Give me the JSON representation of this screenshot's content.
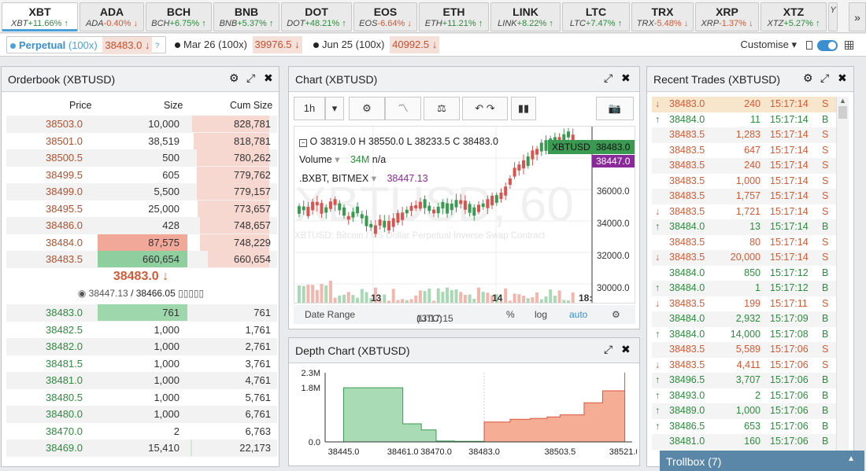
{
  "tickers": [
    {
      "sym": "XBT",
      "code": "XBT",
      "chg": "+11.66%",
      "dir": "up",
      "active": true
    },
    {
      "sym": "ADA",
      "code": "ADA",
      "chg": "-0.40%",
      "dir": "dn"
    },
    {
      "sym": "BCH",
      "code": "BCH",
      "chg": "+6.75%",
      "dir": "up"
    },
    {
      "sym": "BNB",
      "code": "BNB",
      "chg": "+5.37%",
      "dir": "up"
    },
    {
      "sym": "DOT",
      "code": "DOT",
      "chg": "+48.21%",
      "dir": "up"
    },
    {
      "sym": "EOS",
      "code": "EOS",
      "chg": "-6.64%",
      "dir": "dn"
    },
    {
      "sym": "ETH",
      "code": "ETH",
      "chg": "+11.21%",
      "dir": "up"
    },
    {
      "sym": "LINK",
      "code": "LINK",
      "chg": "+8.22%",
      "dir": "up"
    },
    {
      "sym": "LTC",
      "code": "LTC",
      "chg": "+7.47%",
      "dir": "up"
    },
    {
      "sym": "TRX",
      "code": "TRX",
      "chg": "-5.48%",
      "dir": "dn"
    },
    {
      "sym": "XRP",
      "code": "XRP",
      "chg": "-1.37%",
      "dir": "dn"
    },
    {
      "sym": "XTZ",
      "code": "XTZ",
      "chg": "+5.27%",
      "dir": "up"
    },
    {
      "sym": "",
      "code": "Y",
      "chg": "",
      "dir": "up"
    }
  ],
  "more_label": "»",
  "contracts": {
    "perp": {
      "name": "Perpetual",
      "lev": "(100x)",
      "price": "38483.0",
      "arrow": "↓",
      "help": "?"
    },
    "mar": {
      "name": "Mar 26 (100x)",
      "price": "39976.5",
      "arrow": "↓"
    },
    "jun": {
      "name": "Jun 25 (100x)",
      "price": "40992.5",
      "arrow": "↓"
    },
    "customise": "Customise ▾"
  },
  "orderbook": {
    "title": "Orderbook (XBTUSD)",
    "headers": {
      "price": "Price",
      "size": "Size",
      "cum": "Cum Size"
    },
    "asks": [
      {
        "price": "38503.0",
        "size": "10,000",
        "cum": "828,781",
        "cum_frac": 0.98
      },
      {
        "price": "38501.0",
        "size": "38,519",
        "cum": "818,781",
        "cum_frac": 0.96
      },
      {
        "price": "38500.5",
        "size": "500",
        "cum": "780,262",
        "cum_frac": 0.92
      },
      {
        "price": "38499.5",
        "size": "605",
        "cum": "779,762",
        "cum_frac": 0.92
      },
      {
        "price": "38499.0",
        "size": "5,500",
        "cum": "779,157",
        "cum_frac": 0.92
      },
      {
        "price": "38495.5",
        "size": "25,000",
        "cum": "773,657",
        "cum_frac": 0.91
      },
      {
        "price": "38486.0",
        "size": "428",
        "cum": "748,657",
        "cum_frac": 0.88
      },
      {
        "price": "38484.0",
        "size": "87,575",
        "cum": "748,229",
        "cum_frac": 0.88,
        "size_frac": 1.0
      },
      {
        "price": "38483.5",
        "size": "660,654",
        "cum": "660,654",
        "cum_frac": 0.78,
        "size_frac": 1.0
      }
    ],
    "last_price": "38483.0 ↓",
    "index_icon": "◉",
    "index": "38447.13",
    "fair": "/ 38466.05",
    "boxes": "▯▯▯▯▯",
    "bids": [
      {
        "price": "38483.0",
        "size": "761",
        "cum": "761",
        "cum_frac": 0.0,
        "size_frac": 1.0
      },
      {
        "price": "38482.5",
        "size": "1,000",
        "cum": "1,761",
        "cum_frac": 0.0
      },
      {
        "price": "38482.0",
        "size": "1,000",
        "cum": "2,761",
        "cum_frac": 0.0
      },
      {
        "price": "38481.5",
        "size": "1,000",
        "cum": "3,761",
        "cum_frac": 0.0
      },
      {
        "price": "38481.0",
        "size": "1,000",
        "cum": "4,761",
        "cum_frac": 0.0
      },
      {
        "price": "38480.5",
        "size": "1,000",
        "cum": "5,761",
        "cum_frac": 0.0
      },
      {
        "price": "38480.0",
        "size": "1,000",
        "cum": "6,761",
        "cum_frac": 0.0
      },
      {
        "price": "38470.0",
        "size": "2",
        "cum": "6,763",
        "cum_frac": 0.0
      },
      {
        "price": "38469.0",
        "size": "15,410",
        "cum": "22,173",
        "cum_frac": 0.02
      }
    ]
  },
  "chart": {
    "title": "Chart (XBTUSD)",
    "interval": "1h",
    "ohlc": {
      "o_label": "O",
      "o": "38319.0",
      "h_label": "H",
      "h": "38550.0",
      "l_label": "L",
      "l": "38233.5",
      "c_label": "C",
      "c": "38483.0"
    },
    "volume_label": "Volume",
    "volume_value": "34M",
    "volume_na": "n/a",
    "index_label": ".BXBT, BITMEX",
    "index_value": "38447.13",
    "watermark": "XBTUSD, 60",
    "watermark_sub": "XBTUSD: Bitcoin / US Dollar Perpetual Inverse Swap Contract",
    "symbol_tag": "XBTUSD",
    "price_tag": "38483.0",
    "index_tag": "38447.0",
    "y_ticks": [
      "36000.0",
      "34000.0",
      "32000.0",
      "30000.0"
    ],
    "x_ticks": [
      "13",
      "14",
      "18:"
    ],
    "footer": {
      "range": "Date Range",
      "time": "13:17:15",
      "tz": "(UTC)",
      "pct": "%",
      "log": "log",
      "auto": "auto"
    }
  },
  "depth": {
    "title": "Depth Chart (XBTUSD)",
    "y_ticks": [
      "2.3M",
      "1.8M",
      "0.0"
    ],
    "x_ticks": [
      "38445.0",
      "38461.0",
      "38470.0",
      "38483.0",
      "38503.5",
      "38521.0"
    ]
  },
  "chart_data": {
    "type": "area",
    "title": "Depth Chart (XBTUSD)",
    "xlabel": "",
    "ylabel": "",
    "ylim": [
      0,
      2300000
    ],
    "series": [
      {
        "name": "bids",
        "x": [
          38445.0,
          38450.0,
          38461.0,
          38466.0,
          38470.0,
          38475.0,
          38483.0
        ],
        "values": [
          1800000,
          1800000,
          600000,
          400000,
          30000,
          20000,
          0
        ]
      },
      {
        "name": "asks",
        "x": [
          38483.0,
          38490.0,
          38495.5,
          38500.0,
          38503.5,
          38510.0,
          38515.0,
          38521.0
        ],
        "values": [
          660000,
          750000,
          780000,
          830000,
          900000,
          1300000,
          1700000,
          2300000
        ]
      }
    ]
  },
  "trades": {
    "title": "Recent Trades (XBTUSD)",
    "rows": [
      {
        "price": "38483.0",
        "size": "240",
        "time": "15:17:14",
        "side": "S",
        "arrow": "↓",
        "hl": true
      },
      {
        "price": "38484.0",
        "size": "11",
        "time": "15:17:14",
        "side": "B",
        "arrow": "↑"
      },
      {
        "price": "38483.5",
        "size": "1,283",
        "time": "15:17:14",
        "side": "S",
        "arrow": ""
      },
      {
        "price": "38483.5",
        "size": "647",
        "time": "15:17:14",
        "side": "S",
        "arrow": ""
      },
      {
        "price": "38483.5",
        "size": "240",
        "time": "15:17:14",
        "side": "S",
        "arrow": ""
      },
      {
        "price": "38483.5",
        "size": "1,000",
        "time": "15:17:14",
        "side": "S",
        "arrow": ""
      },
      {
        "price": "38483.5",
        "size": "1,757",
        "time": "15:17:14",
        "side": "S",
        "arrow": ""
      },
      {
        "price": "38483.5",
        "size": "1,721",
        "time": "15:17:14",
        "side": "S",
        "arrow": "↓"
      },
      {
        "price": "38484.0",
        "size": "13",
        "time": "15:17:14",
        "side": "B",
        "arrow": "↑"
      },
      {
        "price": "38483.5",
        "size": "80",
        "time": "15:17:14",
        "side": "S",
        "arrow": ""
      },
      {
        "price": "38483.5",
        "size": "20,000",
        "time": "15:17:14",
        "side": "S",
        "arrow": "↓"
      },
      {
        "price": "38484.0",
        "size": "850",
        "time": "15:17:12",
        "side": "B",
        "arrow": ""
      },
      {
        "price": "38484.0",
        "size": "1",
        "time": "15:17:12",
        "side": "B",
        "arrow": "↑"
      },
      {
        "price": "38483.5",
        "size": "199",
        "time": "15:17:11",
        "side": "S",
        "arrow": "↓"
      },
      {
        "price": "38484.0",
        "size": "2,932",
        "time": "15:17:09",
        "side": "B",
        "arrow": ""
      },
      {
        "price": "38484.0",
        "size": "14,000",
        "time": "15:17:08",
        "side": "B",
        "arrow": "↑"
      },
      {
        "price": "38483.5",
        "size": "5,589",
        "time": "15:17:06",
        "side": "S",
        "arrow": ""
      },
      {
        "price": "38483.5",
        "size": "4,411",
        "time": "15:17:06",
        "side": "S",
        "arrow": "↓"
      },
      {
        "price": "38496.5",
        "size": "3,707",
        "time": "15:17:06",
        "side": "B",
        "arrow": "↑"
      },
      {
        "price": "38493.0",
        "size": "2",
        "time": "15:17:06",
        "side": "B",
        "arrow": "↑"
      },
      {
        "price": "38489.0",
        "size": "1,000",
        "time": "15:17:06",
        "side": "B",
        "arrow": "↑"
      },
      {
        "price": "38486.5",
        "size": "653",
        "time": "15:17:06",
        "side": "B",
        "arrow": "↑"
      },
      {
        "price": "38481.0",
        "size": "160",
        "time": "15:17:06",
        "side": "B",
        "arrow": ""
      },
      {
        "price": "38481.0",
        "size": "160",
        "time": "15:17:06",
        "side": "B",
        "arrow": ""
      }
    ]
  },
  "trollbox": "Trollbox (7)",
  "colors": {
    "up": "#2e8b3e",
    "down": "#d15b36",
    "accent": "#3a8fd0"
  }
}
